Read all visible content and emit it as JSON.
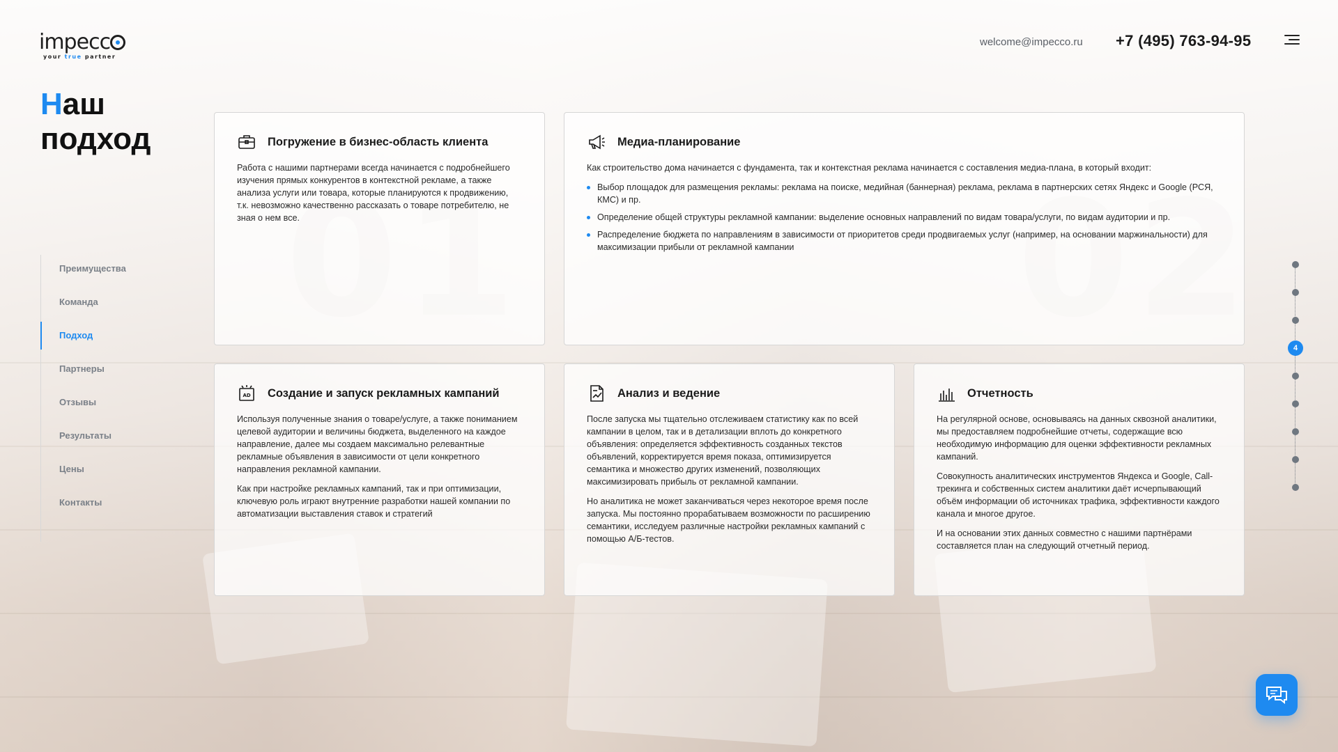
{
  "brand": {
    "name": "impecco",
    "tagline_parts": [
      "your",
      "true",
      "partner"
    ]
  },
  "header": {
    "email": "welcome@impecco.ru",
    "phone": "+7 (495) 763-94-95",
    "menu_icon": "hamburger-icon"
  },
  "page": {
    "title_first_letter": "Н",
    "title_rest_line1": "аш",
    "title_line2": "подход"
  },
  "sidenav": {
    "items": [
      {
        "label": "Преимущества",
        "active": false
      },
      {
        "label": "Команда",
        "active": false
      },
      {
        "label": "Подход",
        "active": true
      },
      {
        "label": "Партнеры",
        "active": false
      },
      {
        "label": "Отзывы",
        "active": false
      },
      {
        "label": "Результаты",
        "active": false
      },
      {
        "label": "Цены",
        "active": false
      },
      {
        "label": "Контакты",
        "active": false
      }
    ]
  },
  "cards": [
    {
      "icon": "briefcase-icon",
      "title": "Погружение в бизнес-область клиента",
      "paragraphs": [
        "Работа с нашими партнерами всегда начинается с подробнейшего изучения прямых конкурентов в контекстной рекламе, а также анализа услуги или товара, которые планируются к продвижению, т.к. невозможно качественно рассказать о товаре потребителю, не зная о нем все."
      ]
    },
    {
      "icon": "megaphone-icon",
      "title": "Медиа-планирование",
      "paragraphs": [
        "Как строительство дома начинается с фундамента, так и контекстная реклама начинается с составления медиа-плана, в который входит:"
      ],
      "bullets": [
        "Выбор площадок для размещения рекламы: реклама на поиске, медийная (баннерная) реклама, реклама в партнерских сетях Яндекс и Google (РСЯ, КМС) и пр.",
        "Определение общей структуры рекламной кампании: выделение основных направлений по видам товара/услуги, по видам аудитории и пр.",
        "Распределение бюджета по направлениям в зависимости от приоритетов среди продвигаемых услуг (например, на основании маржинальности) для максимизации прибыли от рекламной кампании"
      ]
    },
    {
      "icon": "ad-icon",
      "title": "Создание и запуск рекламных кампаний",
      "paragraphs": [
        "Используя полученные знания о товаре/услуге, а также пониманием целевой аудитории и величины бюджета, выделенного на каждое направление, далее мы создаем максимально релевантные рекламные объявления в зависимости от цели конкретного направления рекламной кампании.",
        "Как при настройке рекламных кампаний, так и при оптимизации, ключевую роль играют внутренние разработки нашей компании по автоматизации выставления ставок и стратегий"
      ]
    },
    {
      "icon": "analytics-document-icon",
      "title": "Анализ и ведение",
      "paragraphs": [
        "После запуска мы тщательно отслеживаем статистику как по всей кампании в целом, так и в детализации вплоть до конкретного объявления: определяется эффективность созданных текстов объявлений, корректируется время показа, оптимизируется семантика и множество других изменений, позволяющих максимизировать прибыль от рекламной кампании.",
        "Но аналитика не может заканчиваться через некоторое время после запуска. Мы постоянно прорабатываем возможности по расширению семантики, исследуем различные настройки рекламных кампаний с помощью А/Б-тестов."
      ]
    },
    {
      "icon": "bar-chart-icon",
      "title": "Отчетность",
      "paragraphs": [
        "На регулярной основе, основываясь на данных сквозной аналитики, мы предоставляем подробнейшие отчеты, содержащие всю необходимую информацию для оценки эффективности рекламных кампаний.",
        "Совокупность аналитических инструментов Яндекса и Google, Call-трекинга и собственных систем аналитики даёт исчерпывающий объём информации об источниках трафика, эффективности каждого канала и многое другое.",
        "И на основании этих данных совместно с нашими партнёрами составляется план на следующий отчетный период."
      ]
    }
  ],
  "pager": {
    "current": "4",
    "count": 9,
    "active_index": 3
  },
  "chat": {
    "icon": "chat-icon"
  },
  "colors": {
    "accent": "#1e8af0",
    "text": "#1a1a1a",
    "muted": "#7a8088"
  }
}
